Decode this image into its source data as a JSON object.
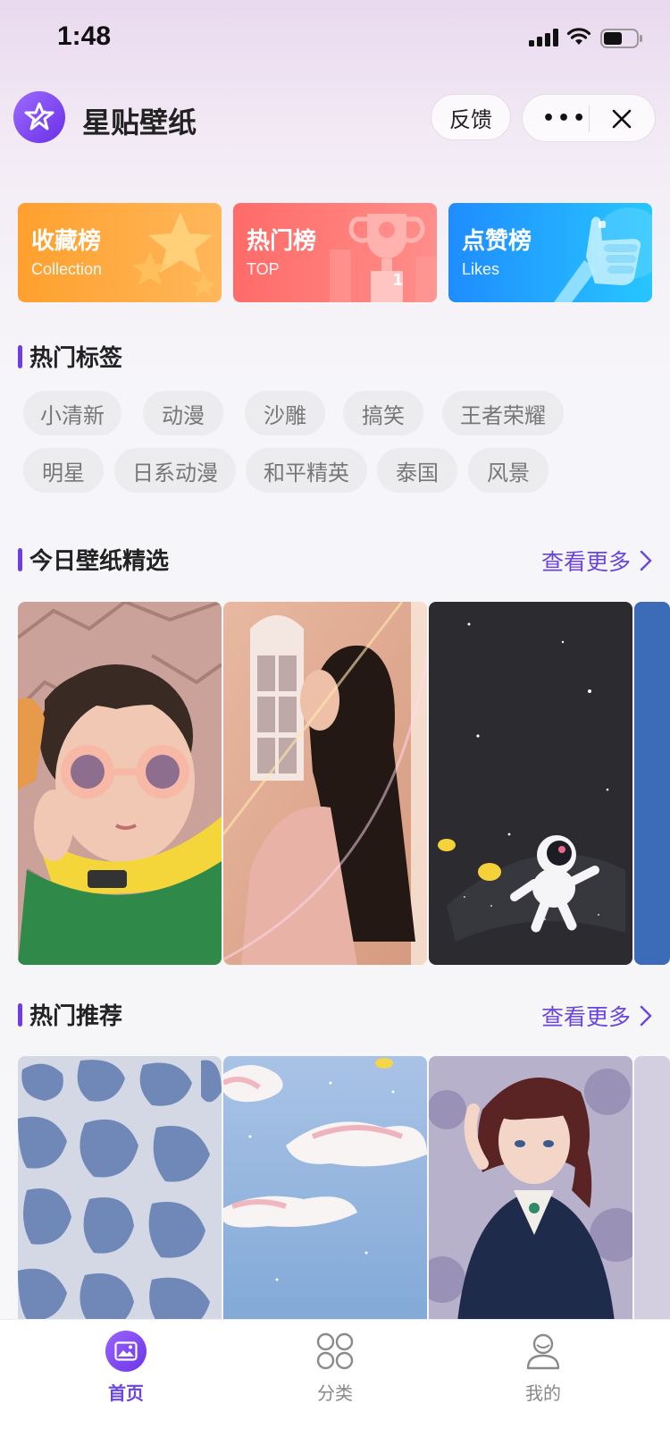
{
  "status": {
    "time": "1:48"
  },
  "nav": {
    "title": "星贴壁纸",
    "feedback": "反馈",
    "more": "•••"
  },
  "ranks": [
    {
      "title": "收藏榜",
      "subtitle": "Collection"
    },
    {
      "title": "热门榜",
      "subtitle": "TOP",
      "badge": "1"
    },
    {
      "title": "点赞榜",
      "subtitle": "Likes"
    }
  ],
  "hot_tags": {
    "title": "热门标签",
    "row1": [
      "小清新",
      "动漫",
      "沙雕",
      "搞笑",
      "王者荣耀"
    ],
    "row2": [
      "明星",
      "日系动漫",
      "和平精英",
      "泰国",
      "风景"
    ]
  },
  "today": {
    "title": "今日壁纸精选",
    "more": "查看更多"
  },
  "recommend": {
    "title": "热门推荐",
    "more": "查看更多"
  },
  "tabs": [
    {
      "label": "首页",
      "icon": "image-icon"
    },
    {
      "label": "分类",
      "icon": "grid-icon"
    },
    {
      "label": "我的",
      "icon": "user-icon"
    }
  ],
  "colors": {
    "accent": "#6a45e0",
    "collection": "#ffa02e",
    "top": "#ff6b68",
    "likes": "#1f8cff"
  }
}
